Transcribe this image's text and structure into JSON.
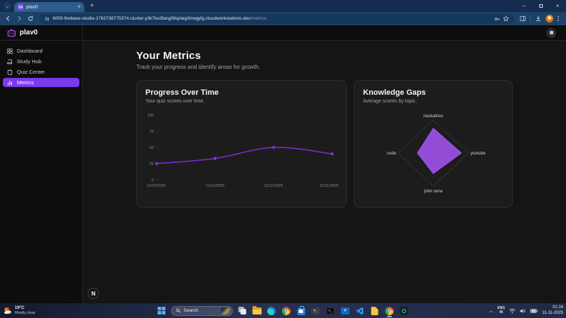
{
  "browser": {
    "tab_title": "plav0",
    "url_host": "6000-firebase-studio-1762738775374.cluster-y3k7ko3fang56qzieg3trwgyfg.cloudworkstations.dev",
    "url_path": "/metrics"
  },
  "app": {
    "brand": "plav0",
    "dev_badge": "N",
    "sidebar": {
      "items": [
        {
          "label": "Dashboard",
          "icon": "dashboard",
          "active": false
        },
        {
          "label": "Study Hub",
          "icon": "study",
          "active": false
        },
        {
          "label": "Quiz Center",
          "icon": "quiz",
          "active": false
        },
        {
          "label": "Metrics",
          "icon": "metrics",
          "active": true
        }
      ]
    },
    "page": {
      "title": "Your Metrics",
      "subtitle": "Track your progress and identify areas for growth."
    }
  },
  "chart_data": [
    {
      "type": "line",
      "title": "Progress Over Time",
      "subtitle": "Your quiz scores over time.",
      "x": [
        "11/10/2025",
        "11/11/2025",
        "11/11/2025",
        "11/11/2025"
      ],
      "series": [
        {
          "name": "score",
          "values": [
            25,
            33,
            50,
            40
          ]
        }
      ],
      "ylim": [
        0,
        100
      ],
      "yticks": [
        0,
        25,
        50,
        75,
        100
      ],
      "line_color": "#8a2be2",
      "grid": "dotted",
      "legend": false
    },
    {
      "type": "radar",
      "title": "Knowledge Gaps",
      "subtitle": "Average scores by topic.",
      "categories": [
        "hackathon",
        "youtube",
        "john cena",
        "code"
      ],
      "values": [
        75,
        80,
        62,
        45
      ],
      "max": 100,
      "fill_color": "#a855f7",
      "fill_opacity": 0.85,
      "grid": "dashed"
    }
  ],
  "taskbar": {
    "weather": {
      "temp": "19°C",
      "condition": "Mostly clear"
    },
    "search_label": "Search",
    "pinned_icons": [
      "task-view",
      "file-explorer",
      "edge",
      "chrome",
      "store",
      "terminal",
      "command-prompt",
      "powershell",
      "vscode",
      "notes",
      "chrome-active",
      "teal-app"
    ],
    "tray": {
      "language": "ENG",
      "region": "IN",
      "time": "01:24",
      "date": "11-11-2025"
    }
  }
}
